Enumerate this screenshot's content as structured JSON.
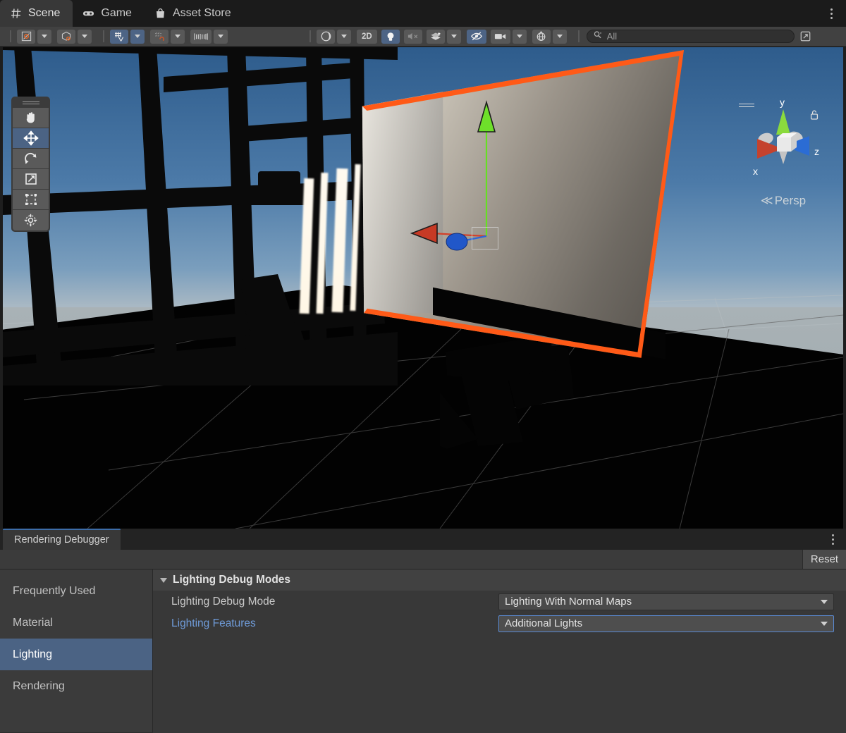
{
  "window": {
    "tabs": [
      {
        "label": "Scene",
        "icon": "grid-icon",
        "active": true
      },
      {
        "label": "Game",
        "icon": "gamepad-icon",
        "active": false
      },
      {
        "label": "Asset Store",
        "icon": "shopping-bag-icon",
        "active": false
      }
    ],
    "overflow_menu": "kebab-menu-icon"
  },
  "scene_toolbar": {
    "pivot_mode": {
      "icon": "pivot-center-icon",
      "label": ""
    },
    "pivot_rotation": {
      "icon": "global-handle-icon",
      "label": ""
    },
    "grid_snapping": {
      "icon": "grid-snap-icon",
      "label": "",
      "active": true
    },
    "snap_increment": {
      "icon": "snap-increment-icon",
      "label": "",
      "active": false
    },
    "grid_visibility": {
      "icon": "grid-ruler-icon",
      "label": ""
    },
    "draw_mode": {
      "icon": "shaded-sphere-icon",
      "label": ""
    },
    "view_2d": {
      "label": "2D",
      "active": false
    },
    "scene_lighting": {
      "icon": "lightbulb-icon",
      "label": "",
      "active": true
    },
    "audio": {
      "icon": "audio-mute-icon",
      "label": "",
      "active": false
    },
    "effects": {
      "icon": "effects-icon",
      "label": ""
    },
    "hidden_objects": {
      "icon": "eye-slash-icon",
      "label": "",
      "active": true
    },
    "camera": {
      "icon": "camera-icon",
      "label": ""
    },
    "gizmos": {
      "icon": "gizmos-globe-icon",
      "label": ""
    },
    "search": {
      "icon": "search-icon",
      "value": "All",
      "placeholder": "All"
    },
    "fullscreen": {
      "icon": "maximize-icon",
      "label": ""
    }
  },
  "scene_tools_overlay": {
    "handle": "drag-handle",
    "items": [
      {
        "name": "view-tool",
        "icon": "hand-icon",
        "selected": false
      },
      {
        "name": "move-tool",
        "icon": "move-arrows-icon",
        "selected": true
      },
      {
        "name": "rotate-tool",
        "icon": "rotate-icon",
        "selected": false
      },
      {
        "name": "scale-tool",
        "icon": "scale-icon",
        "selected": false
      },
      {
        "name": "rect-tool",
        "icon": "rect-transform-icon",
        "selected": false
      },
      {
        "name": "transform-tool",
        "icon": "transform-icon",
        "selected": false
      }
    ]
  },
  "scene_gizmo": {
    "axis_x": "x",
    "axis_y": "y",
    "axis_z": "z",
    "projection": "Persp",
    "projection_arrow": "≪",
    "lock_icon": "lock-icon",
    "colors": {
      "x": "#c9452e",
      "y": "#7dd429",
      "z": "#2b6cd4",
      "selection": "#ff5a17"
    }
  },
  "rendering_debugger": {
    "panel_tab": "Rendering Debugger",
    "overflow_menu": "kebab-menu-icon",
    "reset_button": "Reset",
    "sidebar": [
      {
        "label": "Frequently Used",
        "selected": false
      },
      {
        "label": "Material",
        "selected": false
      },
      {
        "label": "Lighting",
        "selected": true
      },
      {
        "label": "Rendering",
        "selected": false
      }
    ],
    "section": {
      "title": "Lighting Debug Modes",
      "expanded": true,
      "rows": [
        {
          "label": "Lighting Debug Mode",
          "highlighted": false,
          "control": "dropdown",
          "value": "Lighting With Normal Maps",
          "focused": false
        },
        {
          "label": "Lighting Features",
          "highlighted": true,
          "control": "dropdown",
          "value": "Additional Lights",
          "focused": true
        }
      ]
    },
    "accent_color": "#4b6384",
    "focus_color": "#5a8ad4"
  }
}
